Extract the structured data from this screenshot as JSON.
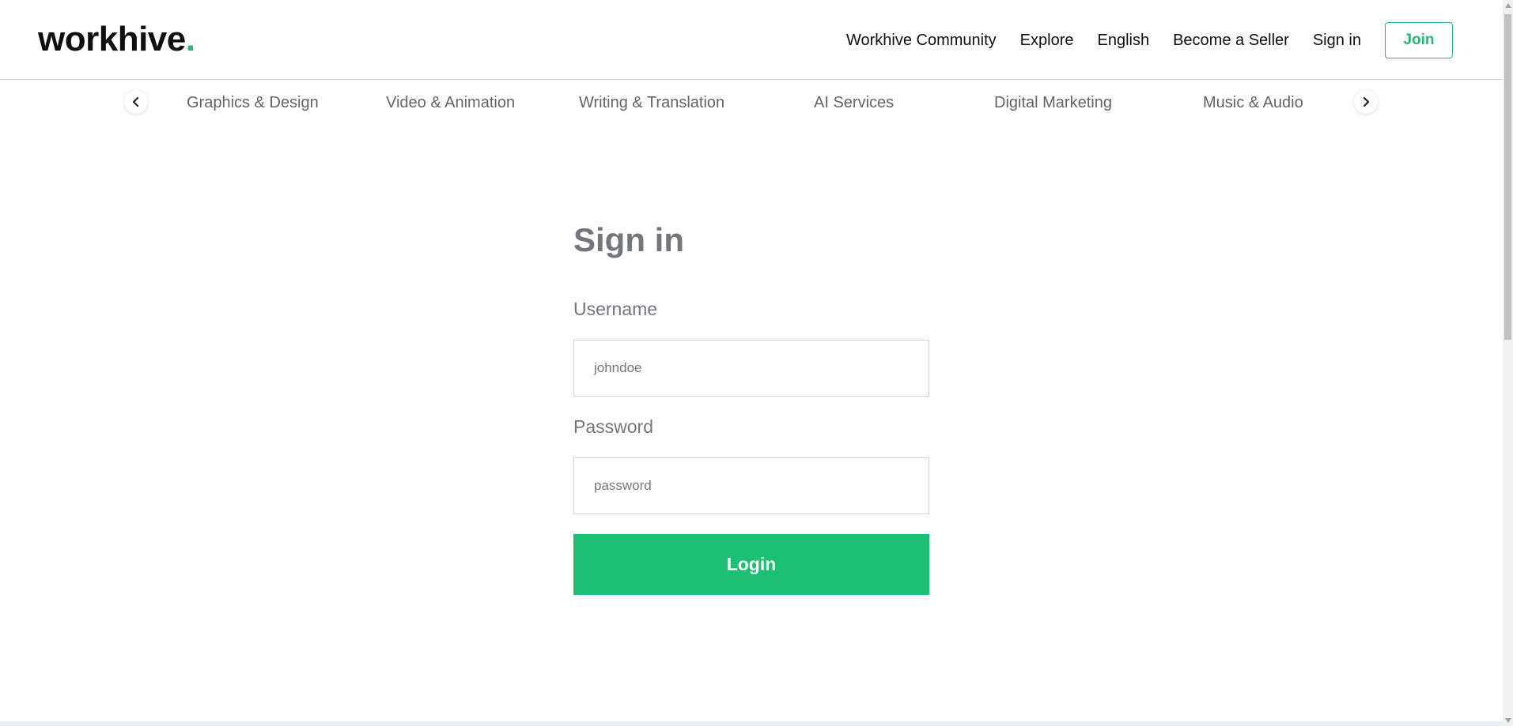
{
  "header": {
    "logo_text": "workhive",
    "logo_dot": ".",
    "nav": {
      "community": "Workhive Community",
      "explore": "Explore",
      "language": "English",
      "become_seller": "Become a Seller",
      "signin": "Sign in",
      "join": "Join"
    }
  },
  "categories": {
    "items": [
      "Graphics & Design",
      "Video & Animation",
      "Writing & Translation",
      "AI Services",
      "Digital Marketing",
      "Music & Audio"
    ]
  },
  "signin_form": {
    "title": "Sign in",
    "username_label": "Username",
    "username_placeholder": "johndoe",
    "password_label": "Password",
    "password_placeholder": "password",
    "login_button": "Login"
  },
  "colors": {
    "brand_green": "#1dbf73",
    "text_dark": "#0e0e0e",
    "text_muted": "#74767e",
    "category_text": "#62646a"
  }
}
